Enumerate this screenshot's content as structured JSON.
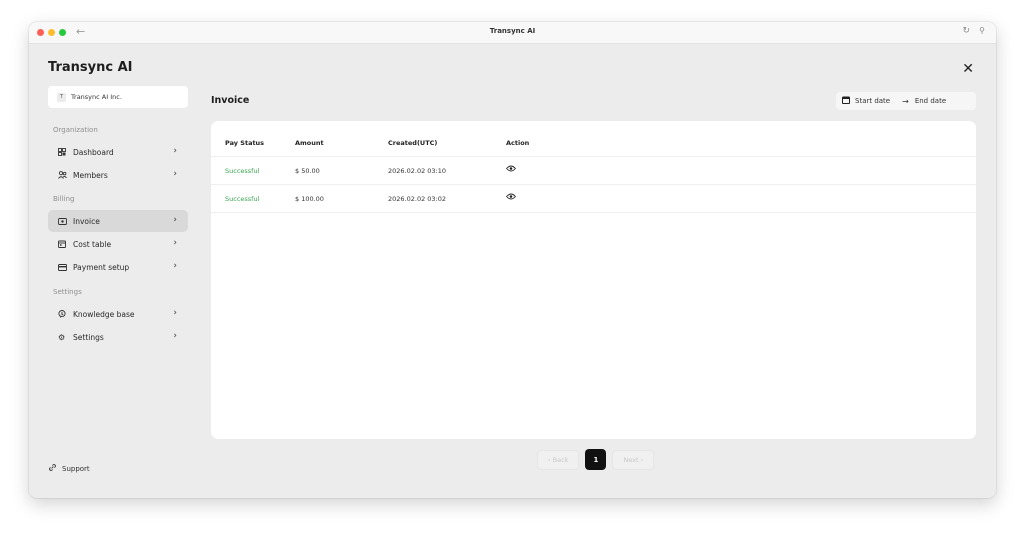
{
  "window": {
    "title": "Transync AI",
    "back_icon": "arrow-left-icon",
    "reload_icon": "reload-icon",
    "pin_icon": "pin-icon"
  },
  "brand": {
    "name": "Transync AI"
  },
  "header": {
    "close_icon": "close-icon"
  },
  "org": {
    "avatar_letter": "T",
    "name": "Transync AI Inc."
  },
  "sidebar": {
    "sections": [
      {
        "label": "Organization"
      },
      {
        "label": "Billing"
      },
      {
        "label": "Settings"
      }
    ],
    "items": [
      {
        "label": "Dashboard",
        "icon": "dashboard-icon",
        "active": false
      },
      {
        "label": "Members",
        "icon": "members-icon",
        "active": false
      },
      {
        "label": "Invoice",
        "icon": "invoice-icon",
        "active": true
      },
      {
        "label": "Cost table",
        "icon": "calendar-icon",
        "active": false
      },
      {
        "label": "Payment setup",
        "icon": "card-icon",
        "active": false
      },
      {
        "label": "Knowledge base",
        "icon": "brain-icon",
        "active": false
      },
      {
        "label": "Settings",
        "icon": "gear-icon",
        "active": false
      }
    ],
    "support": {
      "label": "Support",
      "icon": "link-icon"
    }
  },
  "main": {
    "title": "Invoice",
    "date_range": {
      "start": "Start date",
      "end": "End date"
    },
    "table": {
      "columns": [
        "Pay Status",
        "Amount",
        "Created(UTC)",
        "Action"
      ],
      "rows": [
        {
          "status": "Successful",
          "amount": "$ 50.00",
          "created": "2026.02.02 03:10",
          "action_icon": "eye-icon"
        },
        {
          "status": "Successful",
          "amount": "$ 100.00",
          "created": "2026.02.02 03:02",
          "action_icon": "eye-icon"
        }
      ]
    },
    "pagination": {
      "back": "‹ Back",
      "current": "1",
      "next": "Next ›"
    }
  },
  "colors": {
    "success": "#3aa651",
    "active_nav": "#d9d9d9",
    "page_button": "#111111"
  }
}
